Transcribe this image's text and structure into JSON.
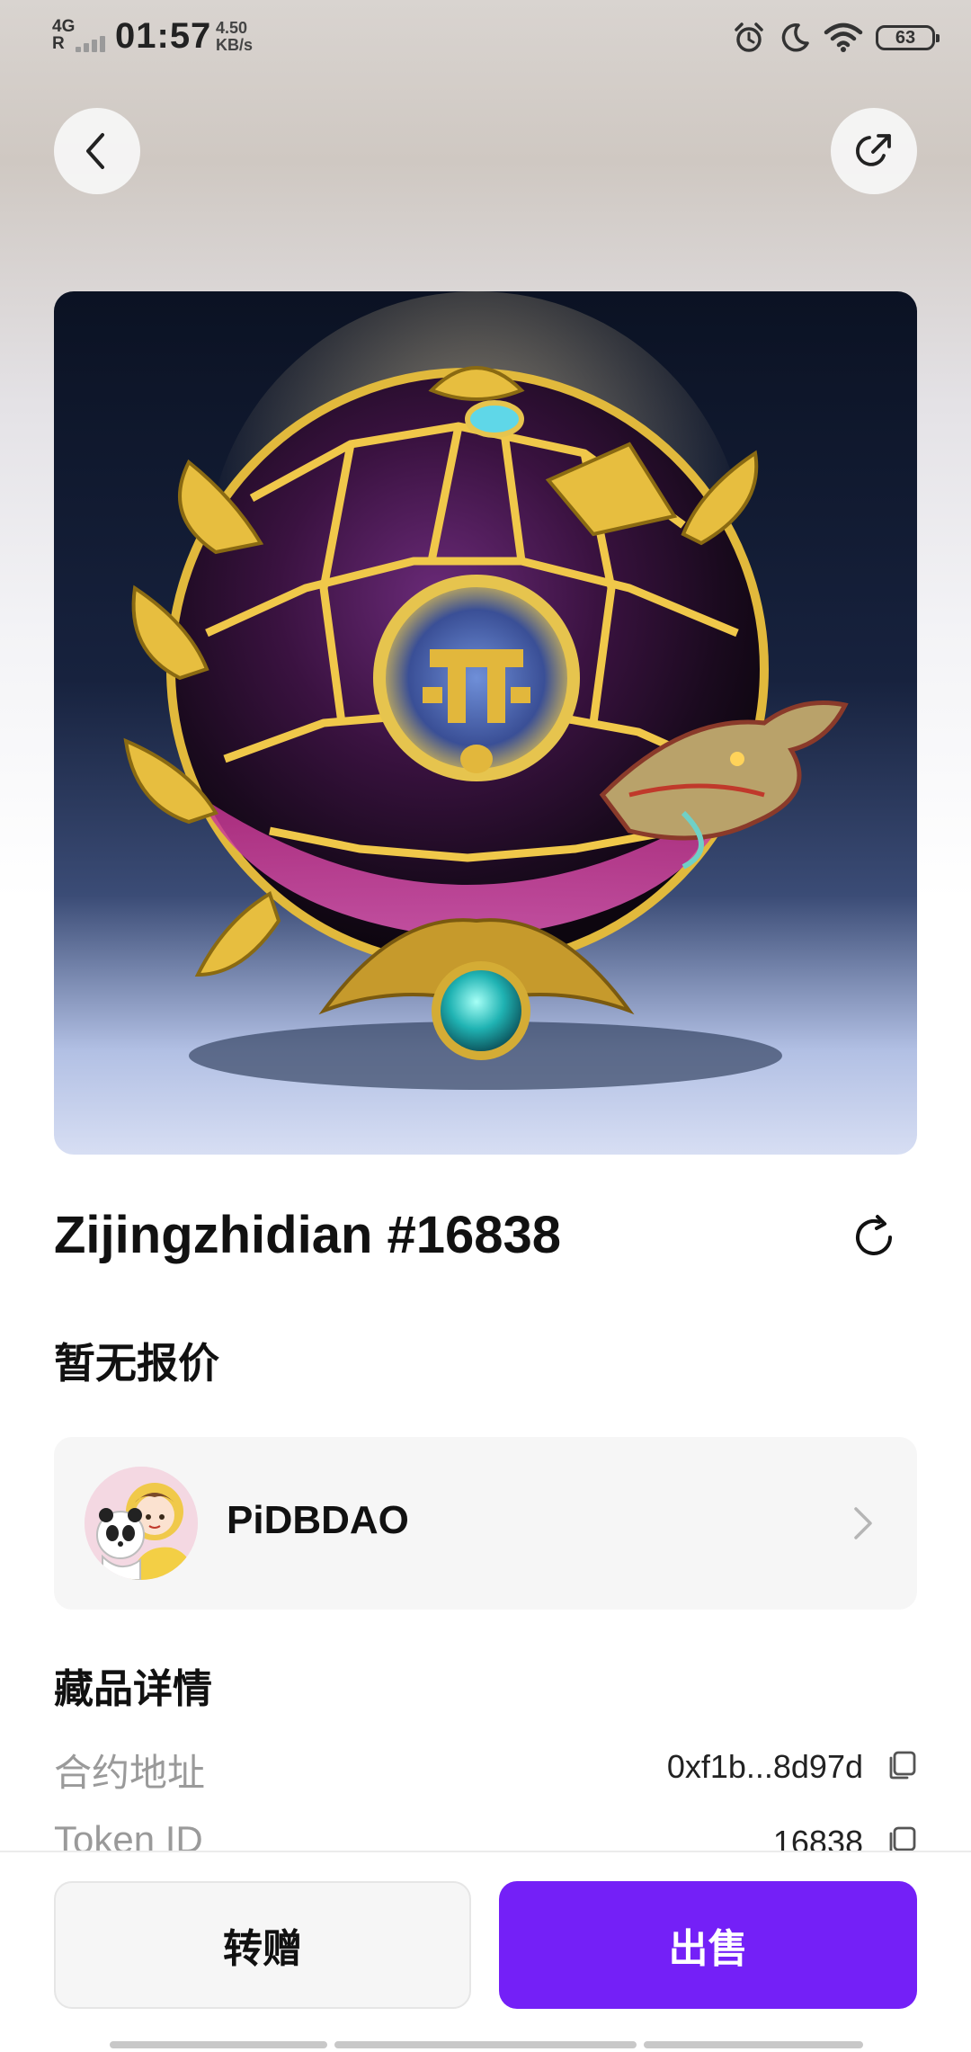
{
  "status_bar": {
    "network": "4G",
    "network_sub": "R",
    "time": "01:57",
    "speed_value": "4.50",
    "speed_unit": "KB/s",
    "battery": "63",
    "icons": [
      "alarm-icon",
      "moon-icon",
      "wifi-icon",
      "battery-icon"
    ]
  },
  "header": {
    "back_icon": "chevron-left-icon",
    "share_icon": "share-icon"
  },
  "nft": {
    "title": "Zijingzhidian #16838",
    "refresh_icon": "refresh-icon",
    "price_text": "暂无报价"
  },
  "owner": {
    "name": "PiDBDAO"
  },
  "details": {
    "section_title": "藏品详情",
    "rows": [
      {
        "label": "合约地址",
        "value": "0xf1b...8d97d"
      },
      {
        "label": "Token ID",
        "value": "16838"
      }
    ]
  },
  "actions": {
    "gift_label": "转赠",
    "sell_label": "出售"
  },
  "colors": {
    "accent": "#7420f7",
    "card_bg": "#f6f6f6",
    "muted_text": "#9a9a9a"
  }
}
